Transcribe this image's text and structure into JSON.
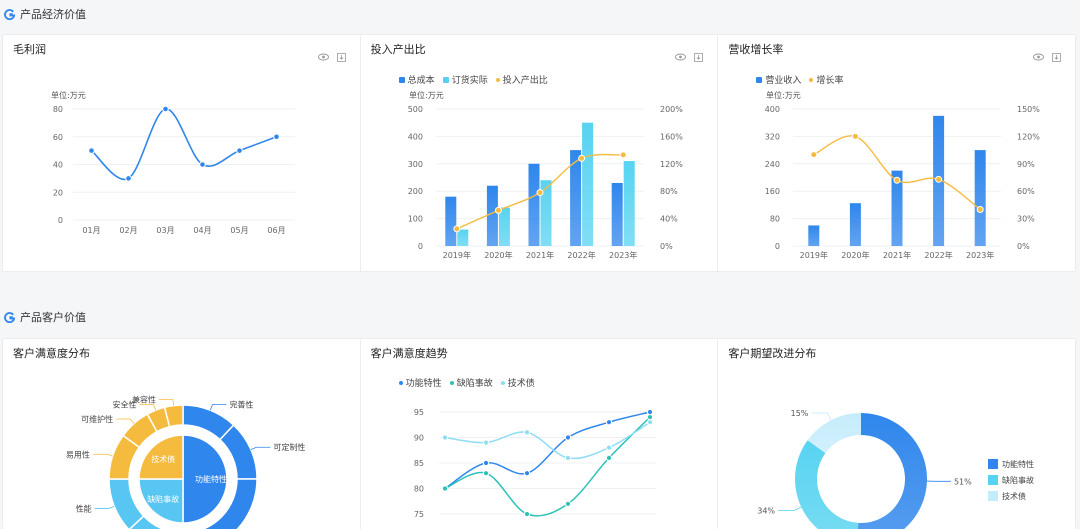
{
  "sections": {
    "econ": "产品经济价值",
    "customer": "产品客户价值"
  },
  "panels": {
    "gross": {
      "title": "毛利润",
      "unit": "单位:万元"
    },
    "io": {
      "title": "投入产出比",
      "unit": "单位:万元"
    },
    "rev": {
      "title": "营收增长率",
      "unit": "单位:万元"
    },
    "sat": {
      "title": "客户满意度分布"
    },
    "trend": {
      "title": "客户满意度趋势"
    },
    "expect": {
      "title": "客户期望改进分布"
    }
  },
  "chart_data": [
    {
      "type": "line",
      "title": "毛利润",
      "categories": [
        "01月",
        "02月",
        "03月",
        "04月",
        "05月",
        "06月"
      ],
      "series": [
        {
          "values": [
            50,
            30,
            80,
            40,
            50,
            60
          ]
        }
      ],
      "ylim": [
        0,
        80
      ],
      "yticks": [
        "0",
        "20",
        "40",
        "60",
        "80"
      ],
      "color": "#2f86ec"
    },
    {
      "type": "bar",
      "title": "投入产出比",
      "categories": [
        "2019年",
        "2020年",
        "2021年",
        "2022年",
        "2023年"
      ],
      "series": [
        {
          "name": "总成本",
          "type": "bar",
          "values": [
            180,
            220,
            300,
            350,
            230
          ],
          "color": "#2f86ec"
        },
        {
          "name": "订货实际",
          "type": "bar",
          "values": [
            60,
            140,
            240,
            450,
            310
          ],
          "color": "#57d3f1"
        },
        {
          "name": "投入产出比",
          "type": "line",
          "axis": "right",
          "values": [
            25,
            52,
            78,
            128,
            133
          ],
          "color": "#f5bb3f"
        }
      ],
      "ylim": [
        0,
        500
      ],
      "yticks": [
        "0",
        "100",
        "200",
        "300",
        "400",
        "500"
      ],
      "y2lim": [
        0,
        200
      ],
      "y2ticks": [
        "0%",
        "40%",
        "80%",
        "120%",
        "160%",
        "200%"
      ],
      "legend": "top"
    },
    {
      "type": "bar",
      "title": "营收增长率",
      "categories": [
        "2019年",
        "2020年",
        "2021年",
        "2022年",
        "2023年"
      ],
      "series": [
        {
          "name": "营业收入",
          "type": "bar",
          "values": [
            60,
            125,
            220,
            380,
            280
          ],
          "color": "#2f86ec"
        },
        {
          "name": "增长率",
          "type": "line",
          "axis": "right",
          "values": [
            100,
            120,
            72,
            73,
            40
          ],
          "color": "#f5bb3f"
        }
      ],
      "ylim": [
        0,
        400
      ],
      "yticks": [
        "0",
        "80",
        "160",
        "240",
        "320",
        "400"
      ],
      "y2lim": [
        0,
        150
      ],
      "y2ticks": [
        "0%",
        "30%",
        "60%",
        "90%",
        "120%",
        "150%"
      ],
      "legend": "top"
    },
    {
      "type": "pie",
      "title": "客户满意度分布",
      "inner": [
        {
          "name": "功能特性",
          "value": 50,
          "color": "#2f86ec"
        },
        {
          "name": "缺陷事故",
          "value": 25,
          "color": "#57c6f3"
        },
        {
          "name": "技术债",
          "value": 25,
          "color": "#f5bb3f"
        }
      ],
      "outer": [
        {
          "name": "完善性",
          "value": 12,
          "color": "#2f86ec"
        },
        {
          "name": "可定制性",
          "value": 13,
          "color": "#2f86ec"
        },
        {
          "name": "",
          "value": 25,
          "color": "#2f86ec"
        },
        {
          "name": "",
          "value": 13,
          "color": "#57c6f3"
        },
        {
          "name": "性能",
          "value": 12,
          "color": "#57c6f3"
        },
        {
          "name": "易用性",
          "value": 10,
          "color": "#f5bb3f"
        },
        {
          "name": "可维护性",
          "value": 7,
          "color": "#f5bb3f"
        },
        {
          "name": "安全性",
          "value": 4,
          "color": "#f5bb3f"
        },
        {
          "name": "兼容性",
          "value": 4,
          "color": "#f5bb3f"
        }
      ]
    },
    {
      "type": "line",
      "title": "客户满意度趋势",
      "series": [
        {
          "name": "功能特性",
          "values": [
            80,
            85,
            83,
            90,
            93,
            95
          ],
          "color": "#2f86ec"
        },
        {
          "name": "缺陷事故",
          "values": [
            80,
            83,
            75,
            77,
            86,
            94
          ],
          "color": "#2cc2b8"
        },
        {
          "name": "技术债",
          "values": [
            90,
            89,
            91,
            86,
            88,
            93
          ],
          "color": "#8fdcf5"
        }
      ],
      "ylim": [
        75,
        95
      ],
      "yticks": [
        "75",
        "80",
        "85",
        "90",
        "95"
      ],
      "legend": "top"
    },
    {
      "type": "pie",
      "title": "客户期望改进分布",
      "slices": [
        {
          "name": "功能特性",
          "value": 51,
          "label": "51%",
          "color": "#2f86ec"
        },
        {
          "name": "缺陷事故",
          "value": 34,
          "label": "34%",
          "color": "#57d3f1"
        },
        {
          "name": "技术债",
          "value": 15,
          "label": "15%",
          "color": "#c6ecfb"
        }
      ],
      "legend": "right"
    }
  ]
}
